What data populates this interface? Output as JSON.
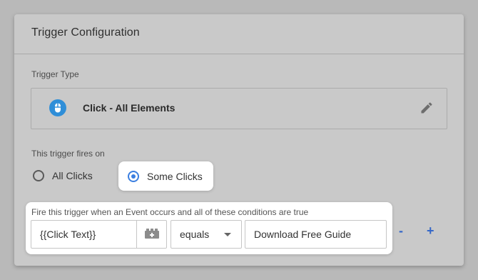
{
  "card": {
    "title": "Trigger Configuration"
  },
  "trigger_type": {
    "label": "Trigger Type",
    "name": "Click - All Elements",
    "icon": "mouse-icon",
    "edit_icon": "pencil-icon"
  },
  "fires_on": {
    "label": "This trigger fires on",
    "options": [
      {
        "label": "All Clicks",
        "selected": false
      },
      {
        "label": "Some Clicks",
        "selected": true
      }
    ]
  },
  "conditions": {
    "description": "Fire this trigger when an Event occurs and all of these conditions are true",
    "rows": [
      {
        "variable": "{{Click Text}}",
        "operator": "equals",
        "value": "Download Free Guide"
      }
    ],
    "remove_label": "-",
    "add_label": "+"
  },
  "colors": {
    "accent": "#3b7fe0",
    "icon_blue": "#2f8ed8",
    "action_blue": "#3567c8",
    "backdrop": "#b9b9b9",
    "card": "#c9c9c9",
    "highlight": "#ffffff"
  }
}
